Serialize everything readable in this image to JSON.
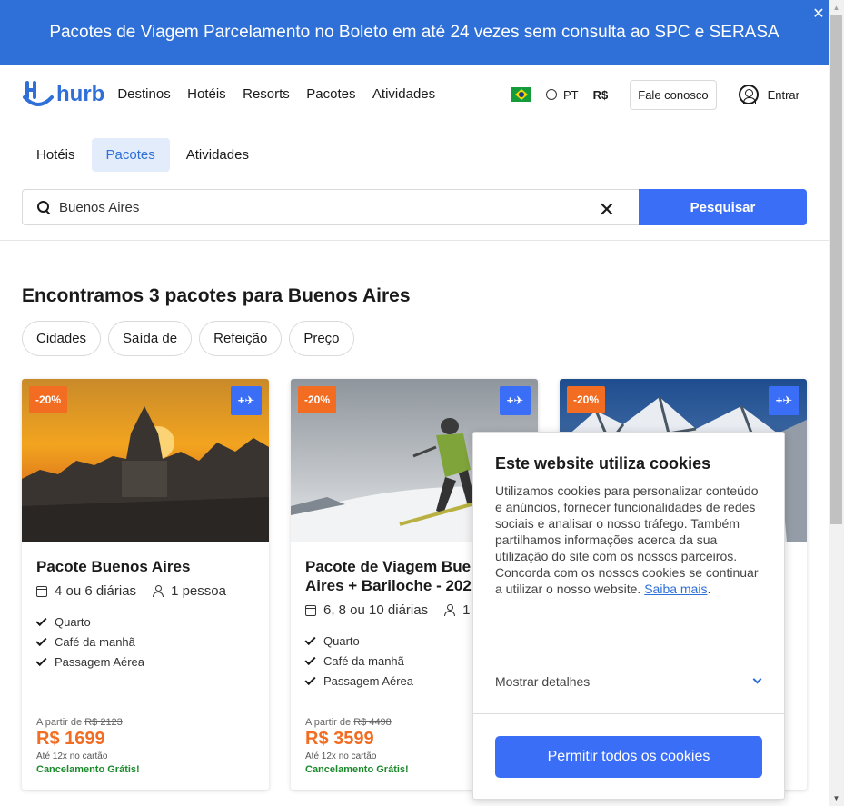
{
  "banner": {
    "text": "Pacotes de Viagem Parcelamento no Boleto em até 24 vezes sem consulta ao SPC e SERASA",
    "close_icon": "✕"
  },
  "header": {
    "logo_text": "hurb",
    "nav": [
      "Destinos",
      "Hotéis",
      "Resorts",
      "Pacotes",
      "Atividades"
    ],
    "language": "PT",
    "currency": "R$",
    "contact_label": "Fale conosco",
    "login_label": "Entrar"
  },
  "search": {
    "tabs": [
      "Hotéis",
      "Pacotes",
      "Atividades"
    ],
    "active_tab": "Pacotes",
    "query": "Buenos Aires",
    "button_label": "Pesquisar"
  },
  "results": {
    "title": "Encontramos 3 pacotes para Buenos Aires",
    "filters": [
      "Cidades",
      "Saída de",
      "Refeição",
      "Preço"
    ]
  },
  "cards": [
    {
      "discount": "-20%",
      "flight_badge": "+✈",
      "title": "Pacote Buenos Aires",
      "nights": "4 ou 6 diárias",
      "people": "1 pessoa",
      "features": [
        "Quarto",
        "Café da manhã",
        "Passagem Aérea"
      ],
      "from_label": "A partir de",
      "old_price": "R$ 2123",
      "price": "R$ 1699",
      "installments": "Até 12x no cartão",
      "cancellation": "Cancelamento Grátis!"
    },
    {
      "discount": "-20%",
      "flight_badge": "+✈",
      "title": "Pacote de Viagem Buenos Aires + Bariloche - 2022",
      "nights": "6, 8 ou 10 diárias",
      "people": "1 pessoa",
      "features": [
        "Quarto",
        "Café da manhã",
        "Passagem Aérea"
      ],
      "from_label": "A partir de",
      "old_price": "R$ 4498",
      "price": "R$ 3599",
      "installments": "Até 12x no cartão",
      "cancellation": "Cancelamento Grátis!"
    },
    {
      "discount": "-20%",
      "flight_badge": "+✈"
    }
  ],
  "cookie": {
    "title": "Este website utiliza cookies",
    "body": "Utilizamos cookies para personalizar conteúdo e anúncios, fornecer funcionalidades de redes sociais e analisar o nosso tráfego. Também partilhamos informações acerca da sua utilização do site com os nossos parceiros. Concorda com os nossos cookies se continuar a utilizar o nosso website.",
    "learn_more": "Saiba mais",
    "details_label": "Mostrar detalhes",
    "allow_label": "Permitir todos os cookies"
  },
  "colors": {
    "brand_blue": "#2e6fd8",
    "button_blue": "#3b6ef6",
    "discount_orange": "#f26c21",
    "success_green": "#1b8a2b"
  }
}
